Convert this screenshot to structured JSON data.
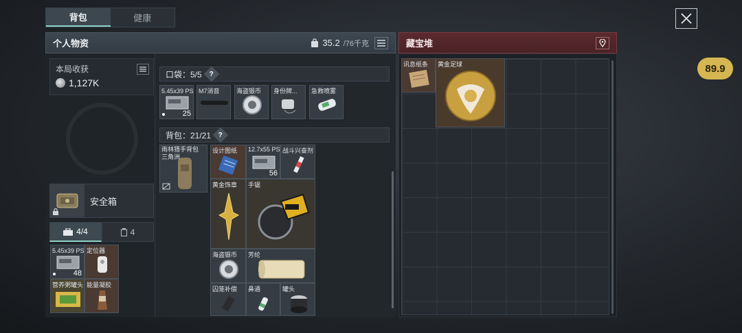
{
  "tabs": [
    {
      "label": "背包"
    },
    {
      "label": "健康"
    }
  ],
  "score": "89.9",
  "panel": {
    "title": "个人物资",
    "weight_current": "35.2",
    "weight_max": "/76千克"
  },
  "loot": {
    "title": "本局收获",
    "value": "1,127K"
  },
  "safe_box": {
    "label": "安全箱"
  },
  "sub_tabs": [
    {
      "label": "4/4"
    },
    {
      "label": "4"
    }
  ],
  "pocket": {
    "title": "口袋：5/5"
  },
  "backpack": {
    "title": "背包：21/21"
  },
  "treasure": {
    "title": "藏宝堆"
  },
  "left_items": [
    {
      "name": "5.45x39 PS弹",
      "count": "48"
    },
    {
      "name": "定位器"
    },
    {
      "name": "营养粥罐头"
    },
    {
      "name": "能量凝胶"
    }
  ],
  "pocket_items": [
    {
      "name": "5.45x39 PS弹",
      "count": "25"
    },
    {
      "name": "M7消音"
    },
    {
      "name": "海盗银币"
    },
    {
      "name": "身份牌..."
    },
    {
      "name": "急救喷雾"
    }
  ],
  "backpack_items": [
    {
      "name": "雨林猎手背包 三角洲"
    },
    {
      "name": "设计图纸"
    },
    {
      "name": "12.7x55 PS12",
      "count": "56"
    },
    {
      "name": "战斗兴奋剂"
    },
    {
      "name": "黄金饰章"
    },
    {
      "name": "手锯"
    },
    {
      "name": "海盗银币"
    },
    {
      "name": "芳纶"
    },
    {
      "name": "囚笼补偿"
    },
    {
      "name": "鼻通"
    },
    {
      "name": "罐头"
    }
  ],
  "treasure_items": [
    {
      "name": "讯息纸条"
    },
    {
      "name": "黄金足球"
    }
  ]
}
